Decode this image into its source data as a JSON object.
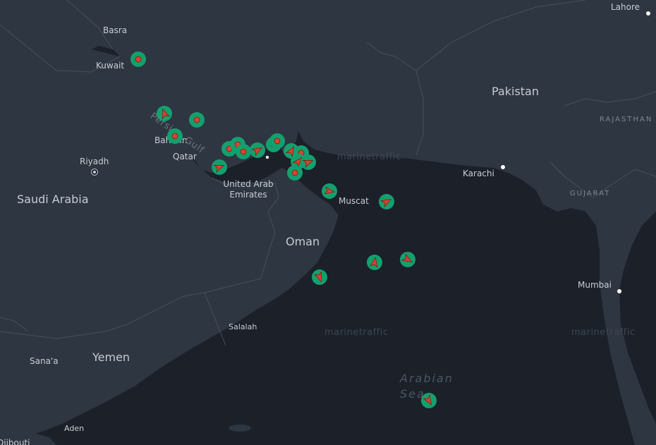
{
  "map": {
    "colors": {
      "land": "#2e3641",
      "water": "#1b2029",
      "border": "#46505c",
      "marker_halo": "#13a06f",
      "marker_fill": "#d9442e"
    },
    "watermark": "marinetraffic",
    "sea_label": "Arabian Sea",
    "gulf_label": "Persian Gulf",
    "countries": [
      "Pakistan",
      "Saudi Arabia",
      "Oman",
      "Yemen",
      "Qatar",
      "United Arab Emirates",
      "Bahrain",
      "Kuwait"
    ],
    "regions": [
      "RAJASTHAN",
      "GUJARAT"
    ],
    "cities": [
      "Lahore",
      "Basra",
      "Kuwait",
      "Riyadh",
      "Karachi",
      "Muscat",
      "Mumbai",
      "Salalah",
      "Sana'a",
      "Aden",
      "Djibouti"
    ],
    "vessel_markers": [
      {
        "type": "vessel-stopped"
      },
      {
        "type": "vessel-underway"
      },
      {
        "type": "vessel-stopped"
      },
      {
        "type": "vessel-stopped"
      },
      {
        "type": "vessel-stopped"
      },
      {
        "type": "vessel-stopped"
      },
      {
        "type": "vessel-stopped"
      },
      {
        "type": "vessel-underway"
      },
      {
        "type": "vessel-stopped"
      },
      {
        "type": "vessel-stopped"
      },
      {
        "type": "vessel-underway"
      },
      {
        "type": "vessel-underway"
      },
      {
        "type": "vessel-stopped"
      },
      {
        "type": "vessel-underway"
      },
      {
        "type": "vessel-stopped"
      },
      {
        "type": "vessel-underway"
      },
      {
        "type": "vessel-underway"
      },
      {
        "type": "vessel-underway"
      },
      {
        "type": "vessel-underway"
      },
      {
        "type": "vessel-underway"
      },
      {
        "type": "vessel-underway"
      },
      {
        "type": "vessel-underway"
      }
    ]
  }
}
